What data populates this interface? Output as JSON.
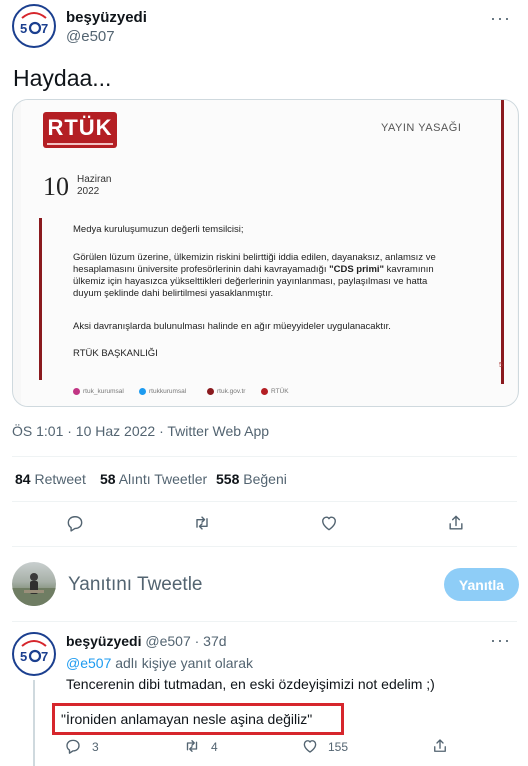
{
  "main_tweet": {
    "author_name": "beşyüzyedi",
    "author_handle": "@e507",
    "text": "Haydaa...",
    "timestamp": "ÖS 1:01 · 10 Haz 2022 · Twitter Web App"
  },
  "image": {
    "logo_text": "RTÜK",
    "header_right": "YAYIN YASAĞI",
    "day": "10",
    "month": "Haziran",
    "year": "2022",
    "greeting": "Medya kuruluşumuzun değerli temsilcisi;",
    "body_line1": "Görülen lüzum üzerine, ülkemizin riskini belirttiği iddia edilen, dayanaksız, anlamsız ve",
    "body_line2_a": "hesaplamasını üniversite profesörlerinin dahi kavrayamadığı ",
    "body_line2_bold": "\"CDS primi\"",
    "body_line2_b": " kavramının",
    "body_line3": "ülkemiz için hayasızca yükselttikleri değerlerinin yayınlanması, paylaşılması ve hatta",
    "body_line4": "duyum şeklinde dahi belirtilmesi yasaklanmıştır.",
    "warning": "Aksi davranışlarda bulunulması halinde en ağır müeyyideler uygulanacaktır.",
    "signature": "RTÜK BAŞKANLIĞI",
    "page_num": "5",
    "social": [
      "rtuk_kurumsal",
      "rtukkurumsal",
      "rtuk.gov.tr",
      "RTÜK"
    ]
  },
  "stats": {
    "retweets_count": "84",
    "retweets_label": "Retweet",
    "quotes_count": "58",
    "quotes_label": "Alıntı Tweetler",
    "likes_count": "558",
    "likes_label": "Beğeni"
  },
  "compose": {
    "placeholder": "Yanıtını Tweetle",
    "button": "Yanıtla"
  },
  "reply": {
    "author_name": "beşyüzyedi",
    "author_handle": "@e507",
    "age": "· 37d",
    "reply_to_handle": "@e507",
    "reply_to_suffix": "adlı kişiye yanıt olarak",
    "text": "Tencerenin dibi tutmadan, en eski özdeyişimizi not edelim ;)",
    "quote": "\"İroniden anlamayan nesle aşina değiliz\"",
    "replies": "3",
    "retweets": "4",
    "likes": "155"
  },
  "colors": {
    "accent": "#1d9bf0",
    "button_disabled": "#8ecdf7",
    "highlight": "#d6262c",
    "rtuk_red": "#b41f24"
  }
}
